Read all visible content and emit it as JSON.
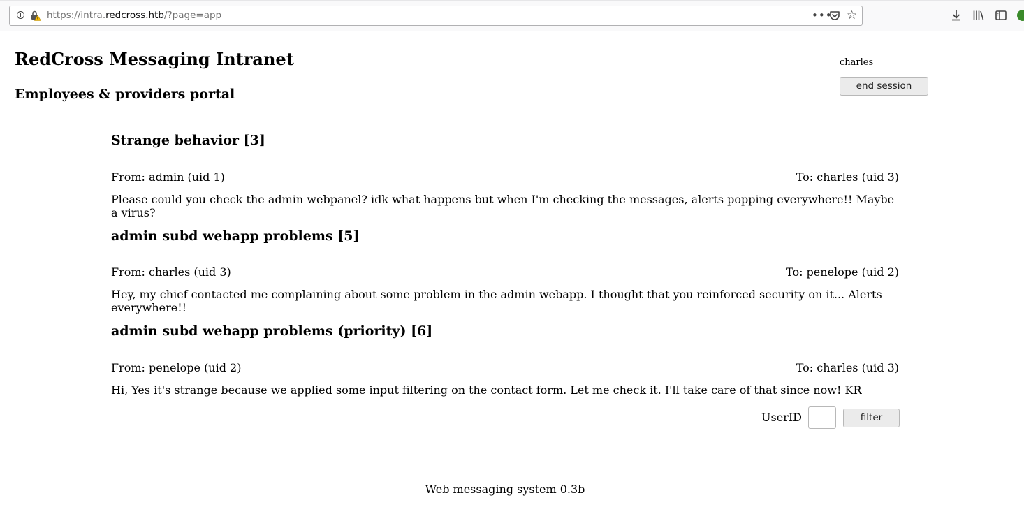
{
  "browser": {
    "url_prefix": "https://intra.",
    "url_host": "redcross.htb",
    "url_path": "/?page=app"
  },
  "header": {
    "title": "RedCross Messaging Intranet",
    "subtitle": "Employees & providers portal",
    "username": "charles",
    "end_session_label": "end session"
  },
  "messages": [
    {
      "title": "Strange behavior [3]",
      "from": "From: admin (uid 1)",
      "to": "To: charles (uid 3)",
      "body": "Please could you check the admin webpanel? idk what happens but when I'm checking the messages, alerts popping everywhere!! Maybe a virus?"
    },
    {
      "title": "admin subd webapp problems [5]",
      "from": "From: charles (uid 3)",
      "to": "To: penelope (uid 2)",
      "body": "Hey, my chief contacted me complaining about some problem in the admin webapp. I thought that you reinforced security on it... Alerts everywhere!!"
    },
    {
      "title": "admin subd webapp problems (priority) [6]",
      "from": "From: penelope (uid 2)",
      "to": "To: charles (uid 3)",
      "body": "Hi, Yes it's strange because we applied some input filtering on the contact form. Let me check it. I'll take care of that since now! KR"
    }
  ],
  "filter": {
    "label": "UserID",
    "value": "",
    "button_label": "filter"
  },
  "footer": {
    "text": "Web messaging system 0.3b"
  }
}
